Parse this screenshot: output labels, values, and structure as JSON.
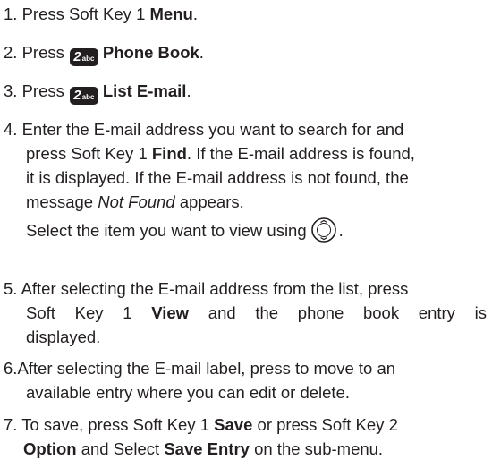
{
  "steps": [
    {
      "num": "1.",
      "pre": "Press Soft Key 1",
      "bold": "Menu",
      "post": "."
    },
    {
      "num": "2.",
      "pre": "Press",
      "key_num": "2",
      "key_abc": "abc",
      "bold": "Phone Book",
      "post": "."
    },
    {
      "num": "3.",
      "pre": "Press",
      "key_num": "2",
      "key_abc": "abc",
      "bold": "List E-mail",
      "post": "."
    },
    {
      "num": "4.",
      "line1": "Enter the E-mail address you want to search for and",
      "line2_pre": "press Soft Key 1",
      "line2_bold": "Find",
      "line2_post": ". If the E-mail address is found,",
      "line3": "it is displayed. If the E-mail address is not found, the",
      "line4_pre": "message",
      "line4_italic": "Not Found",
      "line4_post": "appears.",
      "line5_pre": "Select the item you want to view using",
      "line5_post": "."
    },
    {
      "num": "5.",
      "line1": "After selecting the E-mail address from the list, press",
      "line2_pre": "Soft Key 1",
      "line2_bold": "View",
      "line2_post": "and the phone book entry is",
      "line3": "displayed."
    },
    {
      "num": "6.",
      "line1": "After selecting the E-mail label, press  to move to an",
      "line2": "available entry where you can edit or delete."
    },
    {
      "num": "7.",
      "line1_pre": "To save, press Soft Key 1",
      "line1_bold": "Save",
      "line1_post": "or press Soft Key 2",
      "line2_bold1": "Option",
      "line2_mid": "and Select",
      "line2_bold2": "Save Entry",
      "line2_post": "on the sub-menu."
    }
  ],
  "icons": {
    "key2": "key-2-abc-icon",
    "nav": "navigation-key-icon"
  }
}
